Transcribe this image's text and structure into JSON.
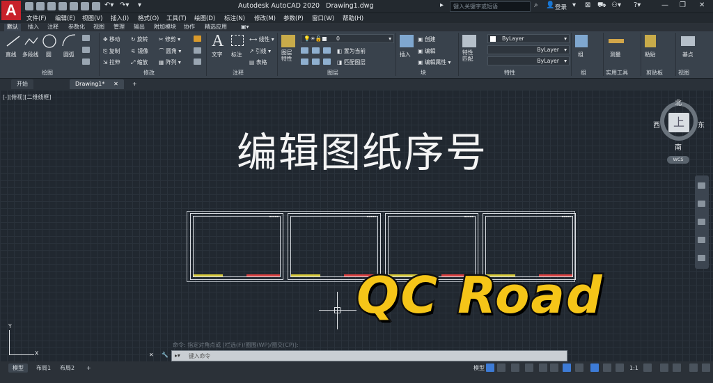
{
  "app": {
    "logo": "A",
    "title": "Autodesk AutoCAD 2020",
    "file": "Drawing1.dwg"
  },
  "search": {
    "placeholder": "键入关键字或短语"
  },
  "user": {
    "login": "登录"
  },
  "menus": [
    "文件(F)",
    "编辑(E)",
    "视图(V)",
    "插入(I)",
    "格式(O)",
    "工具(T)",
    "绘图(D)",
    "标注(N)",
    "修改(M)",
    "参数(P)",
    "窗口(W)",
    "帮助(H)"
  ],
  "ribbon_tabs": [
    "默认",
    "插入",
    "注释",
    "参数化",
    "视图",
    "管理",
    "输出",
    "附加模块",
    "协作",
    "精选应用"
  ],
  "ribbon": {
    "draw": {
      "line": "直线",
      "polyline": "多段线",
      "circle": "圆",
      "arc": "圆弧",
      "title": "绘图"
    },
    "modify": {
      "move": "移动",
      "rotate": "旋转",
      "trim": "修剪",
      "copy": "复制",
      "mirror": "镜像",
      "fillet": "圆角",
      "stretch": "拉伸",
      "scale": "缩放",
      "array": "阵列",
      "title": "修改"
    },
    "annotation": {
      "text": "文字",
      "dim": "标注",
      "linear": "线性",
      "leader": "引线",
      "table": "表格",
      "title": "注释"
    },
    "layers": {
      "props": "图层\n特性",
      "current": "置为当前",
      "match": "匹配图层",
      "layer_value": "0",
      "title": "图层"
    },
    "block": {
      "insert": "插入",
      "create": "创建",
      "edit": "编辑",
      "edit_attr": "编辑属性",
      "title": "块"
    },
    "properties": {
      "match": "特性\n匹配",
      "bylayer1": "ByLayer",
      "bylayer2": "ByLayer",
      "bylayer3": "ByLayer",
      "title": "特性"
    },
    "groups": {
      "group": "组",
      "title": "组"
    },
    "utilities": {
      "measure": "测量",
      "title": "实用工具"
    },
    "clipboard": {
      "paste": "粘贴",
      "title": "剪贴板"
    },
    "view": {
      "base": "基点",
      "title": "视图"
    }
  },
  "doc_tabs": [
    "开始",
    "Drawing1*"
  ],
  "viewport": {
    "label": "[-][俯视][二维线框]"
  },
  "overlay": {
    "title": "编辑图纸序号",
    "brand": "QC Road"
  },
  "viewcube": {
    "north": "北",
    "south": "南",
    "east": "东",
    "west": "西",
    "top": "上",
    "wcs": "WCS"
  },
  "ucs": {
    "x": "X",
    "y": "Y"
  },
  "command": {
    "history": "命令: 指定对角点或 [栏选(F)/圈围(WP)/圈交(CP)]:",
    "placeholder": "键入命令"
  },
  "layout_tabs": [
    "模型",
    "布局1",
    "布局2"
  ],
  "status": {
    "model": "模型",
    "scale": "1:1"
  },
  "colors": {
    "accent": "#f5c518",
    "app_red": "#c8222b",
    "red_label": "#d94040",
    "yellow_label": "#d6c83a"
  }
}
